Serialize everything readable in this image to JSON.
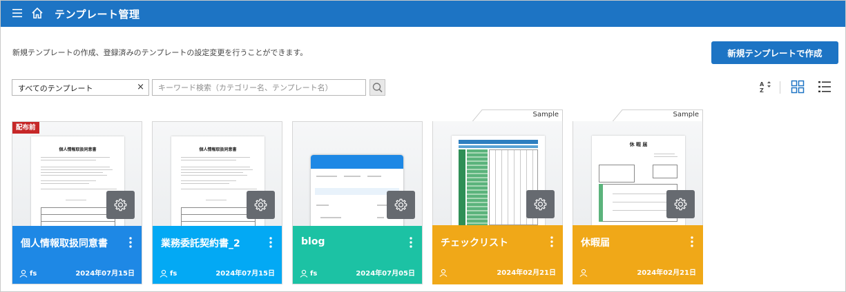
{
  "header": {
    "title": "テンプレート管理",
    "icons": [
      "menu-icon",
      "home-icon"
    ],
    "color": "#1d74c4"
  },
  "description": "新規テンプレートの作成、登録済みのテンプレートの設定変更を行うことができます。",
  "create_button": "新規テンプレートで作成",
  "filter": {
    "value": "すべてのテンプレート",
    "clear": "×"
  },
  "search": {
    "placeholder": "キーワード検索（カテゴリー名、テンプレート名）"
  },
  "toolbar": {
    "icons": [
      "sort-az-icon",
      "grid-view-icon",
      "list-view-icon"
    ],
    "active_view": "grid"
  },
  "cards": [
    {
      "name": "個人情報取扱同意書",
      "author": "fs",
      "date": "2024年07月15日",
      "color": "#1e88e5",
      "badge": "配布前",
      "sample": "",
      "preview_title": "個人情報取扱同意書"
    },
    {
      "name": "業務委託契約書_2",
      "author": "fs",
      "date": "2024年07月15日",
      "color": "#03a9f4",
      "badge": "",
      "sample": "",
      "preview_title": "個人情報取扱同意書"
    },
    {
      "name": "blog",
      "author": "fs",
      "date": "2024年07月05日",
      "color": "#1cc2a4",
      "badge": "",
      "sample": ""
    },
    {
      "name": "チェックリスト",
      "author": "",
      "date": "2024年02月21日",
      "color": "#f0a818",
      "badge": "",
      "sample": "Sample"
    },
    {
      "name": "休暇届",
      "author": "",
      "date": "2024年02月21日",
      "color": "#f0a818",
      "badge": "",
      "sample": "Sample",
      "preview_title": "休 暇 届"
    }
  ]
}
